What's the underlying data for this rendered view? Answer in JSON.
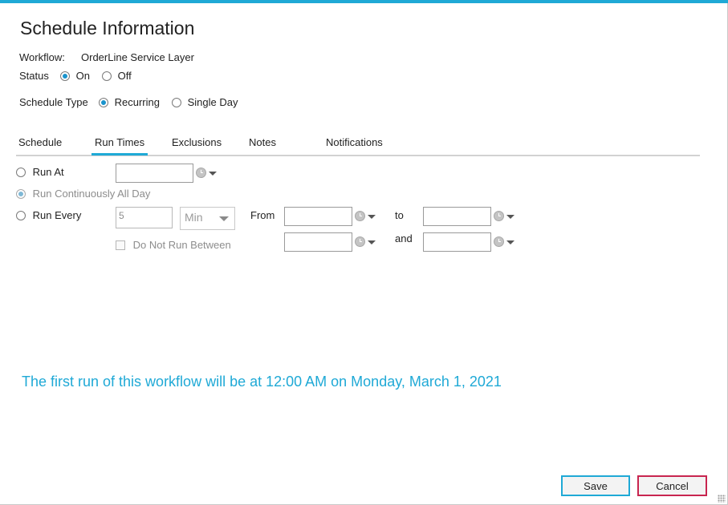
{
  "dialog": {
    "title": "Schedule Information"
  },
  "workflow": {
    "label": "Workflow:",
    "value": "OrderLine Service Layer"
  },
  "status": {
    "label": "Status",
    "options": [
      {
        "label": "On",
        "checked": true
      },
      {
        "label": "Off",
        "checked": false
      }
    ]
  },
  "schedule_type": {
    "label": "Schedule Type",
    "options": [
      {
        "label": "Recurring",
        "checked": true
      },
      {
        "label": "Single Day",
        "checked": false
      }
    ]
  },
  "tabs": [
    {
      "label": "Schedule",
      "active": false
    },
    {
      "label": "Run Times",
      "active": true
    },
    {
      "label": "Exclusions",
      "active": false
    },
    {
      "label": "Notes",
      "active": false
    },
    {
      "label": "Notifications",
      "active": false
    }
  ],
  "run_times": {
    "run_at": {
      "label": "Run At",
      "checked": false,
      "value": ""
    },
    "run_continuously": {
      "label": "Run Continuously All Day",
      "checked": true,
      "disabled": true
    },
    "run_every": {
      "label": "Run Every",
      "checked": false,
      "interval": "5",
      "unit": "Min",
      "from_label": "From",
      "from_value": "",
      "to_label": "to",
      "to_value": ""
    },
    "do_not_run": {
      "label": "Do Not Run Between",
      "checked": false,
      "start_value": "",
      "and_label": "and",
      "end_value": ""
    }
  },
  "message": "The first run of this workflow will be at 12:00 AM on Monday, March 1, 2021",
  "buttons": {
    "save": "Save",
    "cancel": "Cancel"
  },
  "colors": {
    "accent": "#1fa9d6",
    "cancel_border": "#c8254f"
  }
}
